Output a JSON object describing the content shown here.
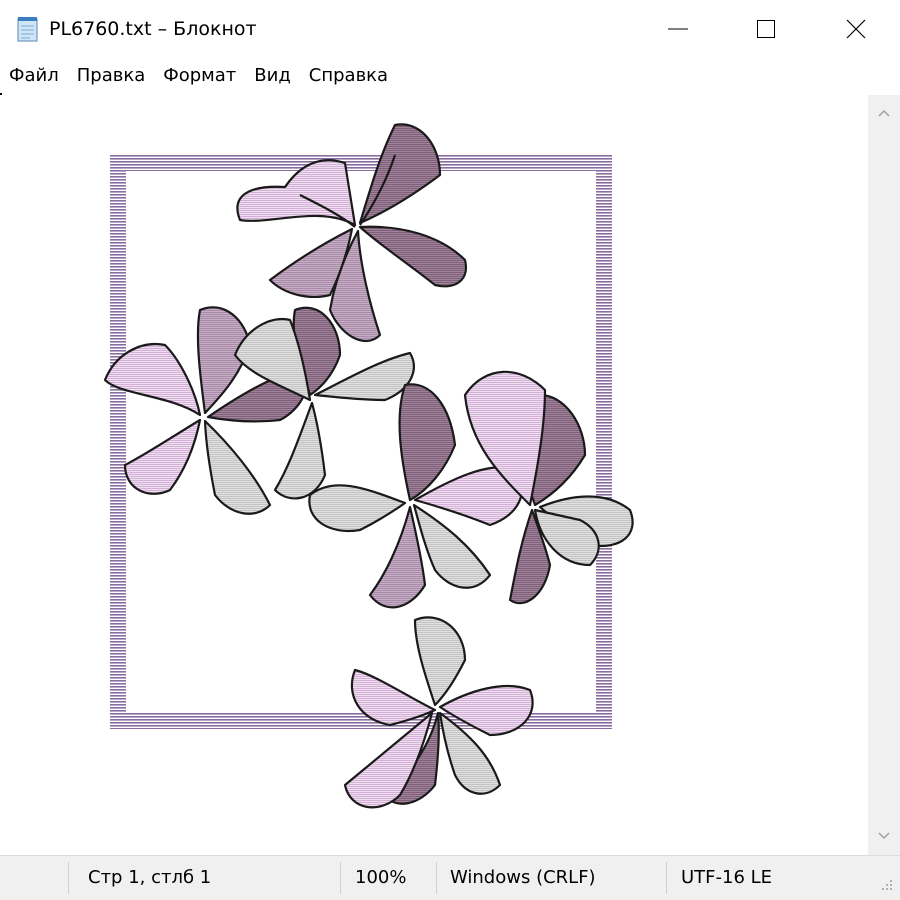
{
  "window": {
    "title": "PL6760.txt – Блокнот"
  },
  "icons": {
    "app": "notepad-icon",
    "minimize": "minimize-icon",
    "maximize": "maximize-icon",
    "close": "close-icon",
    "scroll_up": "chevron-up-icon",
    "scroll_down": "chevron-down-icon",
    "grip": "resize-grip-icon"
  },
  "menu": {
    "items": [
      {
        "label": "Файл"
      },
      {
        "label": "Правка"
      },
      {
        "label": "Формат"
      },
      {
        "label": "Вид"
      },
      {
        "label": "Справка"
      }
    ]
  },
  "status": {
    "position": "Стр 1, стлб 1",
    "zoom": "100%",
    "line_ending": "Windows (CRLF)",
    "encoding": "UTF-16 LE"
  },
  "colors": {
    "frame": "#7a5a8e",
    "petal_light": "#d4b0d8",
    "petal_mid": "#a98aa8",
    "petal_dark": "#7d5f78",
    "petal_gray": "#c2c2c2"
  }
}
